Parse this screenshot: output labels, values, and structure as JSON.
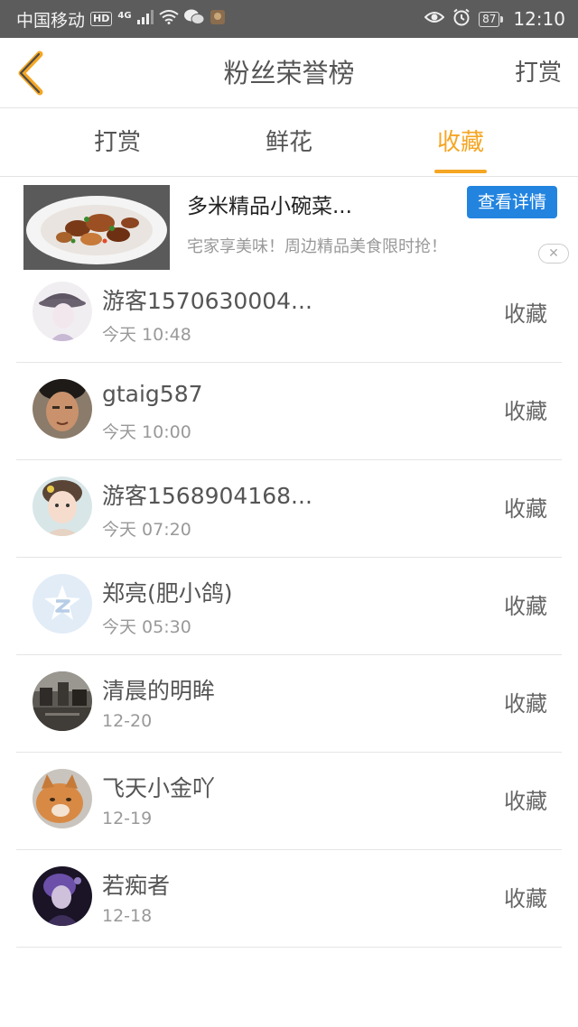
{
  "status_bar": {
    "carrier": "中国移动",
    "hd": "HD",
    "network": "4G",
    "battery": "87",
    "time": "12:10"
  },
  "nav": {
    "title": "粉丝荣誉榜",
    "right_action": "打赏"
  },
  "tabs": [
    {
      "label": "打赏",
      "active": false
    },
    {
      "label": "鲜花",
      "active": false
    },
    {
      "label": "收藏",
      "active": true
    }
  ],
  "ad": {
    "title": "多米精品小碗菜...",
    "description": "宅家享美味！周边精品美食限时抢！",
    "button": "查看详情"
  },
  "fans": [
    {
      "name": "游客1570630004...",
      "time": "今天 10:48",
      "action": "收藏"
    },
    {
      "name": "gtaig587",
      "time": "今天 10:00",
      "action": "收藏"
    },
    {
      "name": "游客1568904168...",
      "time": "今天 07:20",
      "action": "收藏"
    },
    {
      "name": "郑亮(肥小鸽)",
      "time": "今天 05:30",
      "action": "收藏"
    },
    {
      "name": "清晨的明眸",
      "time": "12-20",
      "action": "收藏"
    },
    {
      "name": "飞天小金吖",
      "time": "12-19",
      "action": "收藏"
    },
    {
      "name": "若痴者",
      "time": "12-18",
      "action": "收藏"
    }
  ],
  "colors": {
    "accent": "#f5a623",
    "ad_button": "#2384e0",
    "status_bar": "#5c5c5c"
  }
}
